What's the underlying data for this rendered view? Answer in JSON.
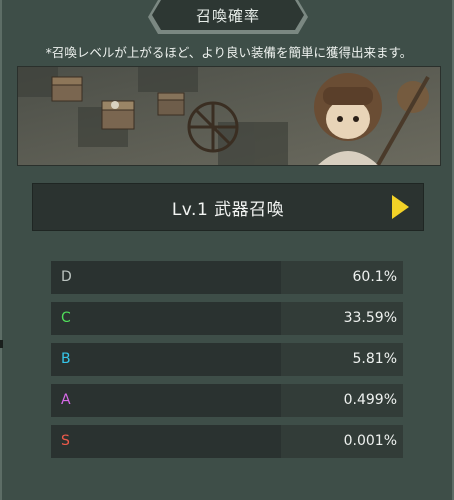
{
  "header": {
    "title": "召喚確率"
  },
  "description": "*召喚レベルが上がるほど、より良い装備を簡単に獲得出来ます。",
  "summon": {
    "label": "Lv.1 武器召喚"
  },
  "rates": [
    {
      "grade": "D",
      "value": "60.1%",
      "color": "#bcc4c0"
    },
    {
      "grade": "C",
      "value": "33.59%",
      "color": "#4fdc5a"
    },
    {
      "grade": "B",
      "value": "5.81%",
      "color": "#36c6ea"
    },
    {
      "grade": "A",
      "value": "0.499%",
      "color": "#d66ae8"
    },
    {
      "grade": "S",
      "value": "0.001%",
      "color": "#ee5a4a"
    }
  ],
  "colors": {
    "accent": "#f3d227",
    "panel": "#3e4e48"
  },
  "icons": {
    "play": "play-arrow-icon"
  }
}
